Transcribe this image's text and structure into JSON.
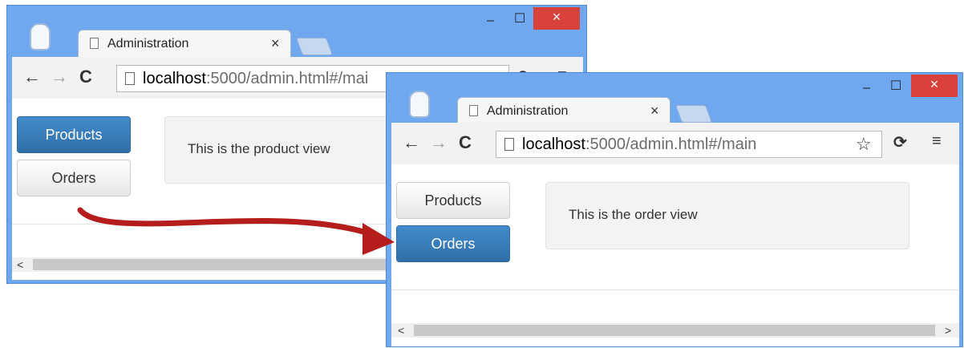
{
  "window1": {
    "tab_title": "Administration",
    "tab_close": "×",
    "min_label": "–",
    "max_label": "☐",
    "close_label": "×",
    "url_host": "localhost",
    "url_rest": ":5000/admin.html#/mai",
    "nav": {
      "products": "Products",
      "orders": "Orders",
      "active": "Products"
    },
    "view_text": "This is the product view"
  },
  "window2": {
    "tab_title": "Administration",
    "tab_close": "×",
    "min_label": "–",
    "max_label": "☐",
    "close_label": "×",
    "url_host": "localhost",
    "url_rest": ":5000/admin.html#/main",
    "nav": {
      "products": "Products",
      "orders": "Orders",
      "active": "Orders"
    },
    "view_text": "This is the order view"
  },
  "toolbar_icons": {
    "back": "←",
    "forward": "→",
    "reload": "C",
    "star": "☆",
    "menu": "≡"
  },
  "colors": {
    "chrome_frame": "#6fa8ef",
    "primary_button": "#428bca",
    "close_button": "#d9413c",
    "transition_arrow": "#b51d1d"
  }
}
